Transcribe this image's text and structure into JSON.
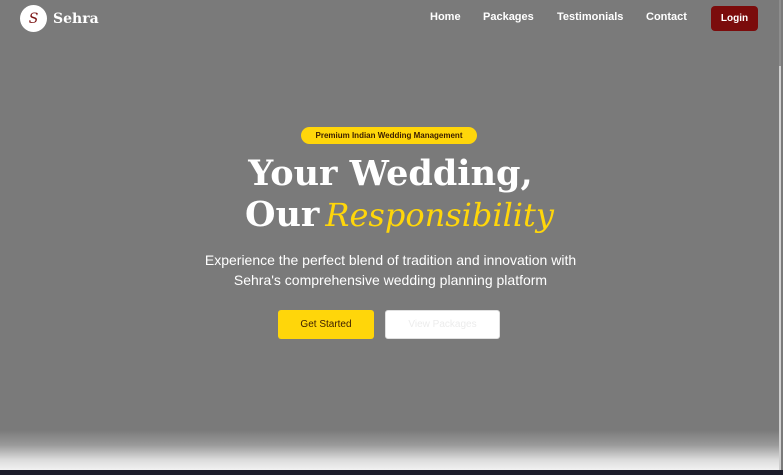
{
  "brand": {
    "mark": "S",
    "name": "Sehra"
  },
  "nav": {
    "links": [
      "Home",
      "Packages",
      "Testimonials",
      "Contact"
    ],
    "login_label": "Login"
  },
  "hero": {
    "badge": "Premium Indian Wedding Management",
    "headline_line1": "Your Wedding,",
    "headline_line2_plain": "Our",
    "headline_line2_script": "Responsibility",
    "subtitle_line1": "Experience the perfect blend of tradition and innovation with",
    "subtitle_line2": "Sehra's comprehensive wedding planning platform",
    "primary_cta": "Get Started",
    "secondary_cta": "View Packages"
  },
  "colors": {
    "accent_gold": "#ffd60a",
    "brand_maroon": "#7b0c0c",
    "overlay_gray": "#7a7a7a"
  }
}
